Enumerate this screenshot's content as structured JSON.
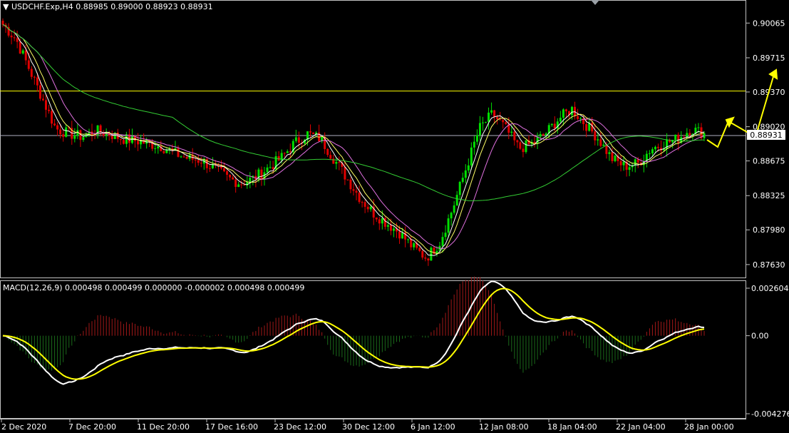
{
  "header": {
    "symbol_label": "USDCHF.Exp,H4",
    "ohlc": "0.88985 0.89000 0.88923 0.88931"
  },
  "price_axis": {
    "ticks": [
      "0.90065",
      "0.89715",
      "0.89370",
      "0.89020",
      "0.88675",
      "0.88325",
      "0.87980",
      "0.87630"
    ],
    "current_price": "0.88931"
  },
  "macd": {
    "label": "MACD(12,26,9) 0.000498 0.000499 0.000000 -0.000002 0.000498 0.000499",
    "ticks": [
      "0.002604",
      "0.00",
      "-0.004276"
    ]
  },
  "time_axis": {
    "labels": [
      "2 Dec 2020",
      "7 Dec 20:00",
      "11 Dec 20:00",
      "17 Dec 16:00",
      "23 Dec 12:00",
      "30 Dec 12:00",
      "6 Jan 12:00",
      "12 Jan 08:00",
      "18 Jan 04:00",
      "22 Jan 04:00",
      "28 Jan 00:00"
    ]
  },
  "colors": {
    "bull": "#00e000",
    "bear": "#e00000",
    "ma_fast": "#ffffff",
    "ma_slow": "#ffff66",
    "ma_mid": "#e070e0",
    "ma_long": "#33cc33",
    "hline": "#ffff00",
    "macd_line": "#ffffff",
    "signal_line": "#ffff00",
    "arrow": "#ffff00"
  },
  "chart_data": {
    "type": "candlestick",
    "ylim": [
      0.8755,
      0.9024
    ],
    "current_price": 0.88931,
    "horizontal_line": 0.8938,
    "closes_approx": [
      0.9005,
      0.899,
      0.896,
      0.893,
      0.89,
      0.8895,
      0.8892,
      0.8898,
      0.8895,
      0.889,
      0.8888,
      0.8885,
      0.8882,
      0.8875,
      0.887,
      0.8868,
      0.886,
      0.885,
      0.8845,
      0.885,
      0.886,
      0.887,
      0.8885,
      0.8895,
      0.889,
      0.887,
      0.885,
      0.883,
      0.8815,
      0.8805,
      0.8795,
      0.878,
      0.877,
      0.8785,
      0.882,
      0.886,
      0.89,
      0.8915,
      0.89,
      0.888,
      0.8885,
      0.8895,
      0.891,
      0.892,
      0.8905,
      0.889,
      0.887,
      0.8862,
      0.8865,
      0.888,
      0.8885,
      0.889,
      0.89,
      0.8895
    ],
    "macd_ylim": [
      -0.004276,
      0.002604
    ]
  }
}
